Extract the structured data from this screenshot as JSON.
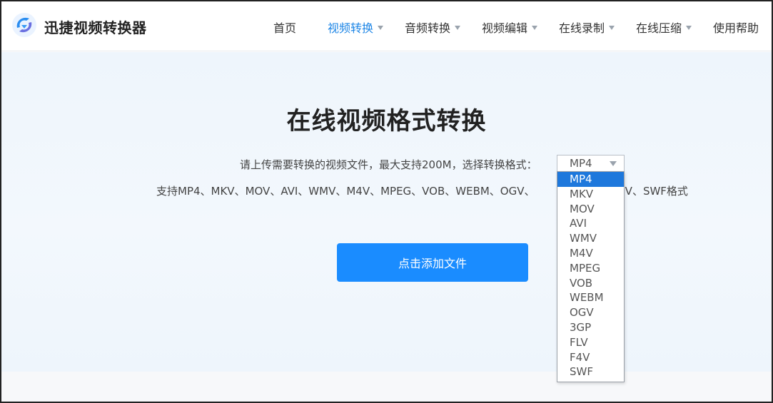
{
  "header": {
    "brand": "迅捷视频转换器",
    "nav": [
      {
        "label": "首页",
        "dropdown": false,
        "active": false
      },
      {
        "label": "视频转换",
        "dropdown": true,
        "active": true
      },
      {
        "label": "音频转换",
        "dropdown": true,
        "active": false
      },
      {
        "label": "视频编辑",
        "dropdown": true,
        "active": false
      },
      {
        "label": "在线录制",
        "dropdown": true,
        "active": false
      },
      {
        "label": "在线压缩",
        "dropdown": true,
        "active": false
      },
      {
        "label": "使用帮助",
        "dropdown": false,
        "active": false
      }
    ]
  },
  "main": {
    "title": "在线视频格式转换",
    "description": "请上传需要转换的视频文件，最大支持200M，选择转换格式：",
    "formats_left": "支持MP4、MKV、MOV、AVI、WMV、M4V、MPEG、VOB、WEBM、OGV、",
    "formats_right": "F4V、SWF格式",
    "format_select": {
      "value": "MP4",
      "options": [
        "MP4",
        "MKV",
        "MOV",
        "AVI",
        "WMV",
        "M4V",
        "MPEG",
        "VOB",
        "WEBM",
        "OGV",
        "3GP",
        "FLV",
        "F4V",
        "SWF"
      ],
      "highlighted": "MP4"
    },
    "upload_button": "点击添加文件"
  },
  "colors": {
    "accent": "#1a8cff",
    "nav_active": "#1e86e6",
    "option_highlight": "#1e78dc"
  },
  "icons": {
    "logo": "swirl-logo-icon",
    "nav_caret": "caret-down-icon",
    "select_caret": "caret-down-icon"
  }
}
